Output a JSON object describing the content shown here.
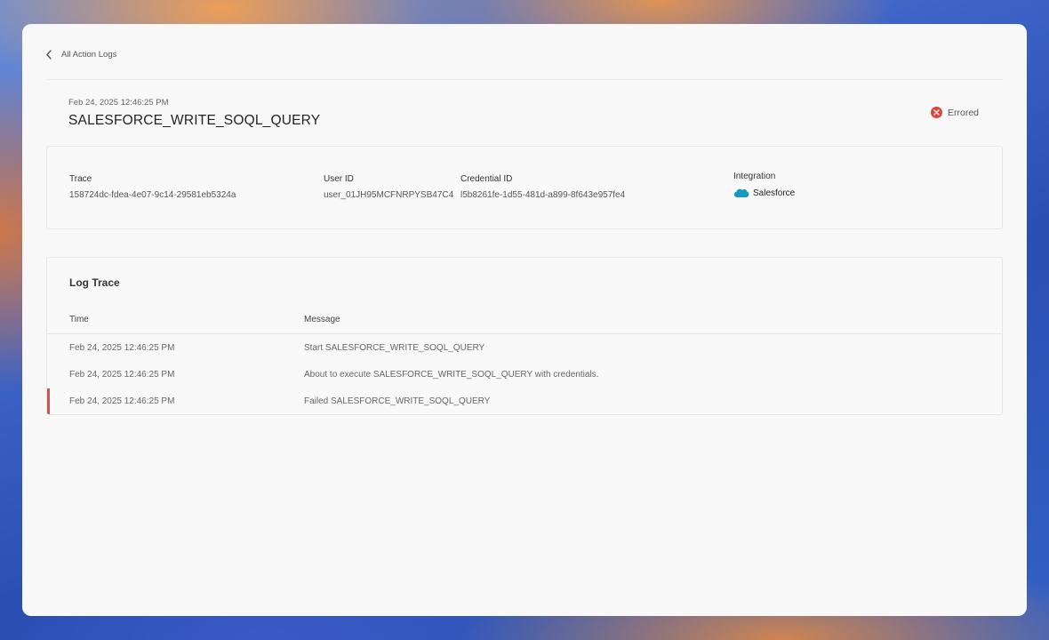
{
  "nav": {
    "back_label": "All Action Logs"
  },
  "header": {
    "timestamp": "Feb 24, 2025 12:46:25 PM",
    "title": "SALESFORCE_WRITE_SOQL_QUERY",
    "status": "Errored",
    "status_color": "#d8453c"
  },
  "details": {
    "trace": {
      "label": "Trace",
      "value": "158724dc-fdea-4e07-9c14-29581eb5324a"
    },
    "user": {
      "label": "User ID",
      "value": "user_01JH95MCFNRPYSB47C4"
    },
    "credential": {
      "label": "Credential ID",
      "value": "l5b8261fe-1d55-481d-a899-8f643e957fe4"
    },
    "integration": {
      "label": "Integration",
      "value": "Salesforce",
      "icon": "salesforce-cloud-icon"
    }
  },
  "log": {
    "title": "Log Trace",
    "columns": {
      "time": "Time",
      "message": "Message"
    },
    "rows": [
      {
        "time": "Feb 24, 2025 12:46:25 PM",
        "message": "Start SALESFORCE_WRITE_SOQL_QUERY"
      },
      {
        "time": "Feb 24, 2025 12:46:25 PM",
        "message": "About to execute SALESFORCE_WRITE_SOQL_QUERY with credentials."
      },
      {
        "time": "Feb 24, 2025 12:46:25 PM",
        "message": "Failed SALESFORCE_WRITE_SOQL_QUERY"
      }
    ]
  },
  "colors": {
    "error_accent": "#c9564c",
    "salesforce_blue": "#1798c1"
  }
}
